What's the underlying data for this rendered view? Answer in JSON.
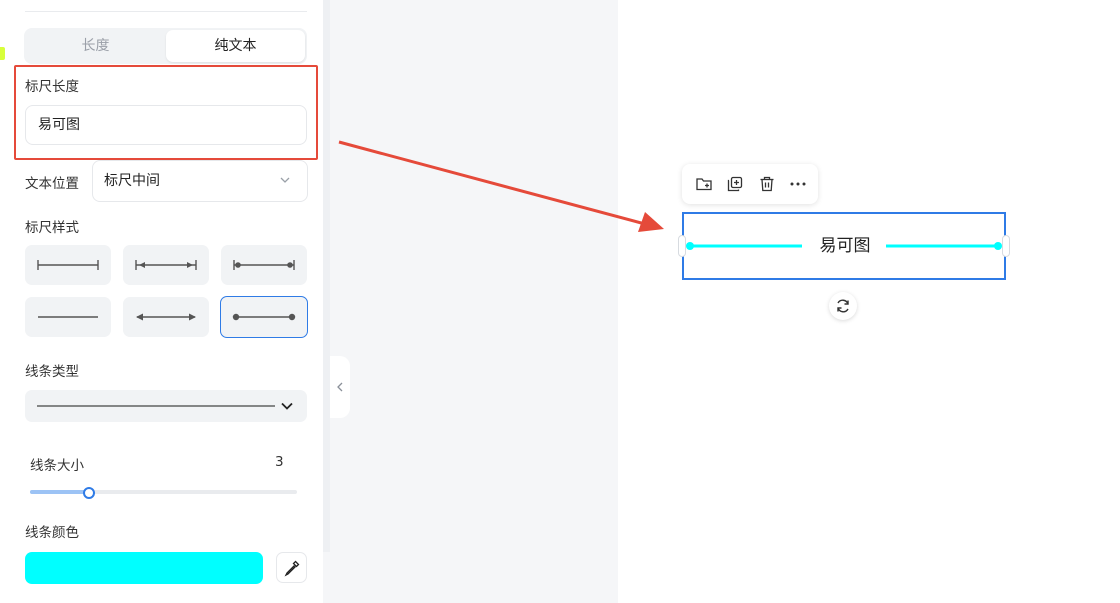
{
  "panel": {
    "tabs": [
      {
        "label": "长度",
        "active": false
      },
      {
        "label": "纯文本",
        "active": true
      }
    ],
    "ruler_length": {
      "label": "标尺长度",
      "value": "易可图"
    },
    "text_position": {
      "label": "文本位置",
      "value": "标尺中间"
    },
    "ruler_style": {
      "label": "标尺样式",
      "selected_index": 5
    },
    "line_type": {
      "label": "线条类型",
      "value": "solid"
    },
    "line_size": {
      "label": "线条大小",
      "value": "3",
      "slider_fraction": 0.22
    },
    "line_color": {
      "label": "线条颜色",
      "value": "#00FFFF"
    }
  },
  "canvas": {
    "toolbar_icons": [
      "folder-add-icon",
      "duplicate-icon",
      "delete-icon",
      "more-icon"
    ],
    "ruler_text": "易可图",
    "ruler_color": "#00FFFF",
    "selection_color": "#2F7BE6"
  },
  "annotation": {
    "color": "#E54A3A"
  }
}
